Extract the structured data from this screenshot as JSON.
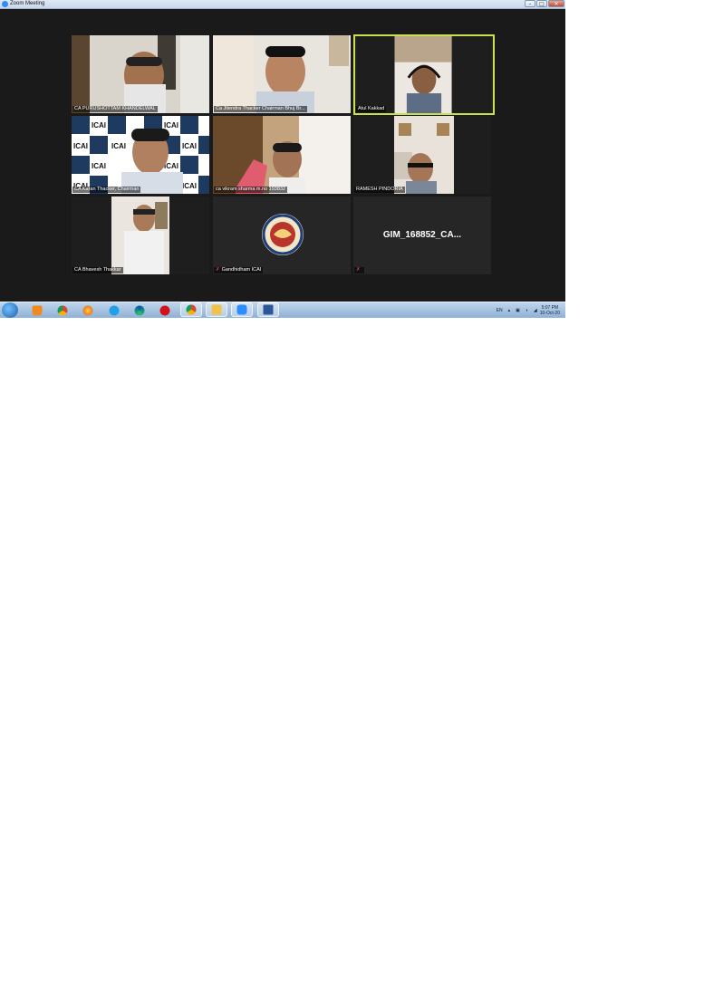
{
  "window": {
    "title": "Zoom Meeting"
  },
  "participants": [
    {
      "name": "CA PURUSHOTTAM KHANDELWAL",
      "type": "video",
      "active": false
    },
    {
      "name": "Ca Jitendra Thacker Chairman Bhuj Br...",
      "type": "video",
      "active": false
    },
    {
      "name": "Atul Kakkad",
      "type": "video",
      "active": true
    },
    {
      "name": "CA Karan Thacker, Chairman",
      "type": "video",
      "active": false
    },
    {
      "name": "ca vikram sharma m.no 193832",
      "type": "video",
      "active": false
    },
    {
      "name": "RAMESH PINDORIA",
      "type": "video",
      "active": false
    },
    {
      "name": "CA Bhavesh Thakkar",
      "type": "video",
      "active": false
    },
    {
      "name": "Gandhidham ICAI",
      "type": "logo",
      "muted": true,
      "active": false
    },
    {
      "name": "",
      "display_name": "GIM_168852_CA...",
      "type": "name",
      "muted": true,
      "active": false
    }
  ],
  "taskbar": {
    "apps": [
      "start-button",
      "vlc-icon",
      "chrome-icon",
      "firefox-icon",
      "ie-icon",
      "edge-icon",
      "opera-icon",
      "chrome-icon",
      "file-explorer-icon",
      "zoom-icon",
      "word-icon"
    ],
    "tray": {
      "lang": "EN",
      "time": "5:07 PM",
      "date": "10-Oct-20"
    }
  },
  "colors": {
    "meeting_bg": "#1a1a1a",
    "tile_bg": "#262626",
    "active_border": "#c9e04f",
    "muted": "#e24a4a"
  }
}
